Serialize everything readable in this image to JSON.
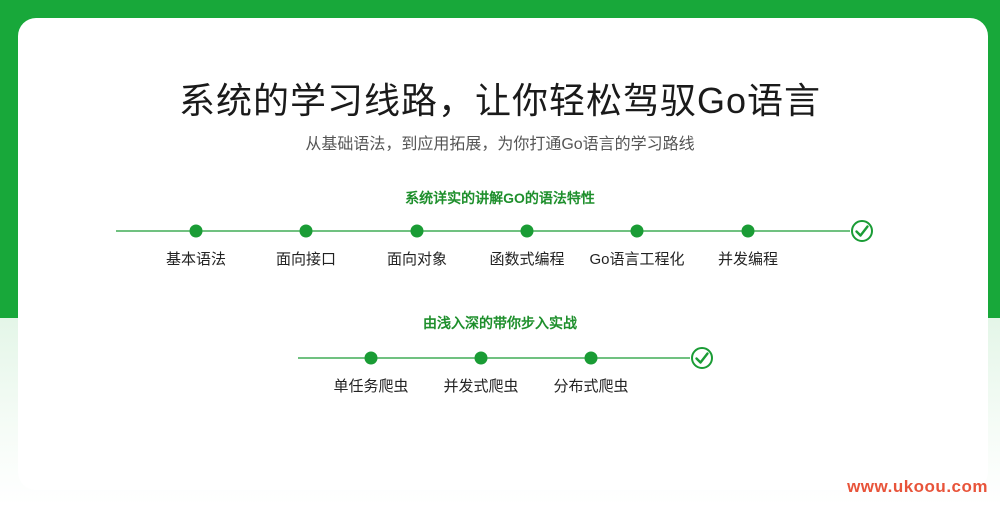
{
  "hero": {
    "title": "系统的学习线路，让你轻松驾驭Go语言",
    "subtitle": "从基础语法，到应用拓展，为你打通Go语言的学习路线"
  },
  "section1": {
    "heading": "系统详实的讲解GO的语法特性",
    "steps": [
      "基本语法",
      "面向接口",
      "面向对象",
      "函数式编程",
      "Go语言工程化",
      "并发编程"
    ]
  },
  "section2": {
    "heading": "由浅入深的带你步入实战",
    "steps": [
      "单任务爬虫",
      "并发式爬虫",
      "分布式爬虫"
    ]
  },
  "watermark": "www.ukoou.com",
  "colors": {
    "brand_green": "#18a83a",
    "dot_green": "#1a9c35",
    "heading_green": "#1e8f2c",
    "watermark": "#e8543a"
  },
  "icons": {
    "end_marker": "check-circle-icon",
    "step_marker": "dot-icon"
  }
}
